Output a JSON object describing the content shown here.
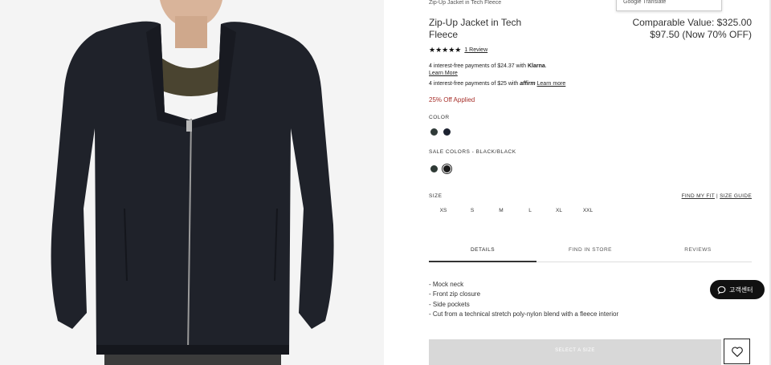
{
  "breadcrumb": "Zip-Up Jacket in Tech Fleece",
  "translate_popup": "Google Translate",
  "product": {
    "title": "Zip-Up Jacket in Tech Fleece",
    "comparable_value": "Comparable Value: $325.00",
    "price": "$97.50 (Now 70% OFF)",
    "stars": "★★★★★",
    "rating": 5,
    "review_link": "1 Review"
  },
  "payments": {
    "klarna_prefix": "4 interest-free payments of $24.37 with ",
    "klarna_brand": "Klarna",
    "klarna_suffix": ".",
    "klarna_learn": "Learn More",
    "affirm_prefix": "4 interest-free payments of $25 with ",
    "affirm_brand": "affirm",
    "affirm_learn": "Learn more"
  },
  "promo": "25% Off Applied",
  "color": {
    "label": "COLOR",
    "swatches": [
      {
        "name": "color-swatch-1",
        "hex": "#2f3a38"
      },
      {
        "name": "color-swatch-2",
        "hex": "#1d2230"
      }
    ]
  },
  "sale_colors": {
    "label": "SALE COLORS - BLACK/BLACK",
    "swatches": [
      {
        "name": "sale-color-swatch-1",
        "hex": "#2e3a35"
      },
      {
        "name": "sale-color-swatch-2",
        "hex": "#1a1a1a",
        "selected": true
      }
    ]
  },
  "size": {
    "label": "SIZE",
    "find_my_fit": "FIND MY FIT",
    "separator": "|",
    "size_guide": "SIZE GUIDE",
    "options": [
      "XS",
      "S",
      "M",
      "L",
      "XL",
      "XXL"
    ]
  },
  "tabs": [
    {
      "label": "DETAILS",
      "active": true
    },
    {
      "label": "FIND IN STORE",
      "active": false
    },
    {
      "label": "REVIEWS",
      "active": false
    }
  ],
  "details": [
    "- Mock neck",
    "- Front zip closure",
    "- Side pockets",
    "- Cut from a technical stretch poly-nylon blend with a fleece interior"
  ],
  "add_to_cart": "SELECT A SIZE",
  "chat_label": "고객센터",
  "icons": {
    "wishlist": "heart-icon",
    "chat": "chat-bubble-icon"
  },
  "colors": {
    "promo": "#a7302b",
    "button_disabled": "#d8d8d8"
  }
}
